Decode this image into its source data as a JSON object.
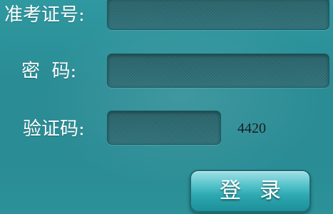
{
  "form": {
    "exam_number_label": "准考证号:",
    "password_label": "密  码:",
    "captcha_label": "验证码:",
    "captcha_code": "4420",
    "login_button_label": "登录",
    "exam_number_value": "",
    "password_value": "",
    "captcha_value": ""
  },
  "colors": {
    "background": "#2a8c95",
    "field": "#2e6b73",
    "button": "#2ea8b1"
  }
}
